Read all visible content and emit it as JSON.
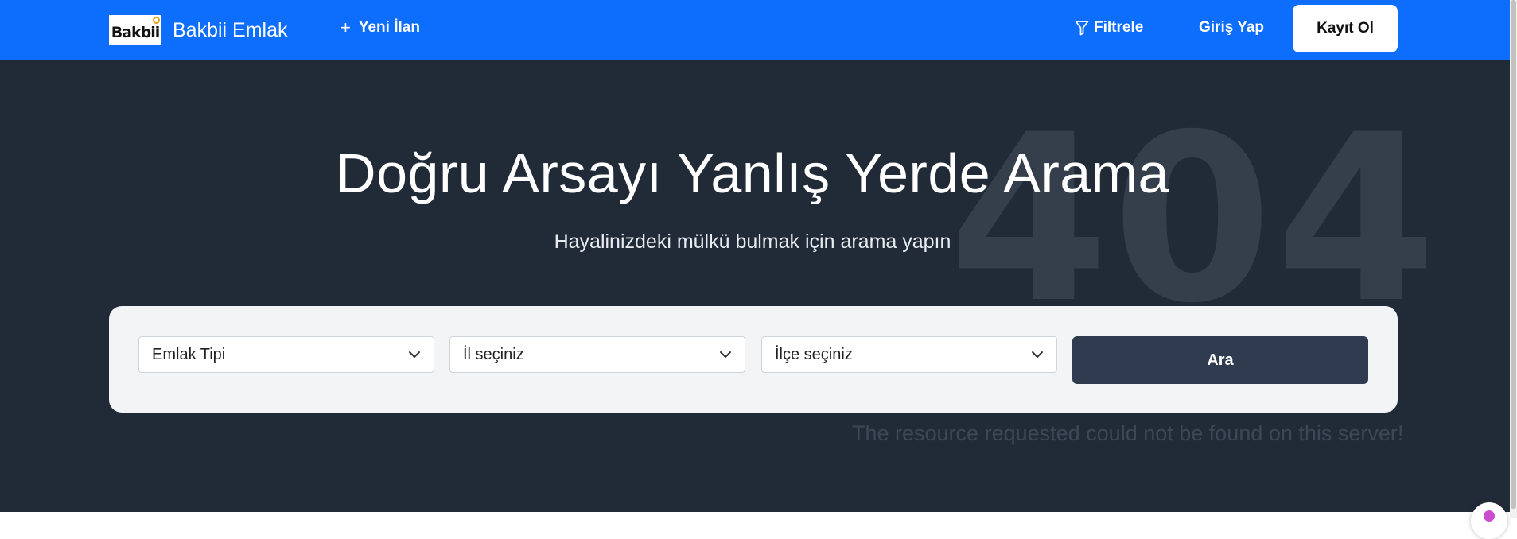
{
  "navbar": {
    "logo_text": "Bakbii",
    "brand_name": "Bakbii Emlak",
    "new_listing": {
      "icon": "plus-icon",
      "label": "Yeni İlan"
    },
    "filter": {
      "icon": "filter-icon",
      "label": "Filtrele"
    },
    "login_label": "Giriş Yap",
    "register_label": "Kayıt Ol"
  },
  "hero": {
    "background_404": "404",
    "title": "Doğru Arsayı Yanlış Yerde Arama",
    "subtitle": "Hayalinizdeki mülkü bulmak için arama yapın",
    "error_message": "The resource requested could not be found on this server!"
  },
  "search": {
    "property_type": {
      "selected": "Emlak Tipi",
      "icon": "chevron-down-icon"
    },
    "province": {
      "selected": "İl seçiniz",
      "icon": "chevron-down-icon"
    },
    "district": {
      "selected": "İlçe seçiniz",
      "icon": "chevron-down-icon"
    },
    "button_label": "Ara"
  },
  "colors": {
    "navbar_bg": "#0d6efd",
    "hero_bg": "#212b38",
    "card_bg": "#f3f4f6",
    "button_bg": "#2f3b4e"
  }
}
